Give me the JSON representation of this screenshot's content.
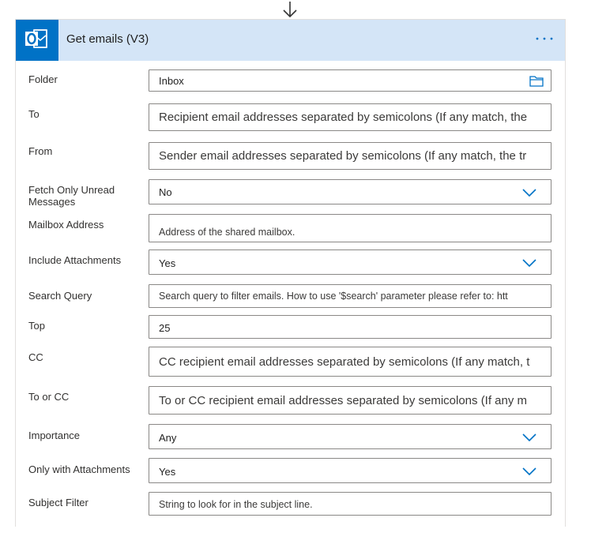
{
  "card": {
    "title": "Get emails (V3)",
    "app_icon": "outlook-icon",
    "menu_icon": "ellipsis-icon",
    "accent_color": "#0072c6",
    "header_color": "#d4e5f7"
  },
  "fields": {
    "folder": {
      "label": "Folder",
      "value": "Inbox",
      "icon": "folder-icon"
    },
    "to": {
      "label": "To",
      "placeholder": "Recipient email addresses separated by semicolons (If any match, the"
    },
    "from": {
      "label": "From",
      "placeholder": "Sender email addresses separated by semicolons (If any match, the tr"
    },
    "fetch_unread": {
      "label": "Fetch Only Unread Messages",
      "value": "No"
    },
    "mailbox": {
      "label": "Mailbox Address",
      "placeholder": "Address of the shared mailbox."
    },
    "include_attachments": {
      "label": "Include Attachments",
      "value": "Yes"
    },
    "search_query": {
      "label": "Search Query",
      "placeholder": "Search query to filter emails. How to use '$search' parameter please refer to: htt"
    },
    "top": {
      "label": "Top",
      "value": "25"
    },
    "cc": {
      "label": "CC",
      "placeholder": "CC recipient email addresses separated by semicolons (If any match, t"
    },
    "to_or_cc": {
      "label": "To or CC",
      "placeholder": "To or CC recipient email addresses separated by semicolons (If any m"
    },
    "importance": {
      "label": "Importance",
      "value": "Any"
    },
    "only_attachments": {
      "label": "Only with Attachments",
      "value": "Yes"
    },
    "subject_filter": {
      "label": "Subject Filter",
      "placeholder": "String to look for in the subject line."
    }
  }
}
